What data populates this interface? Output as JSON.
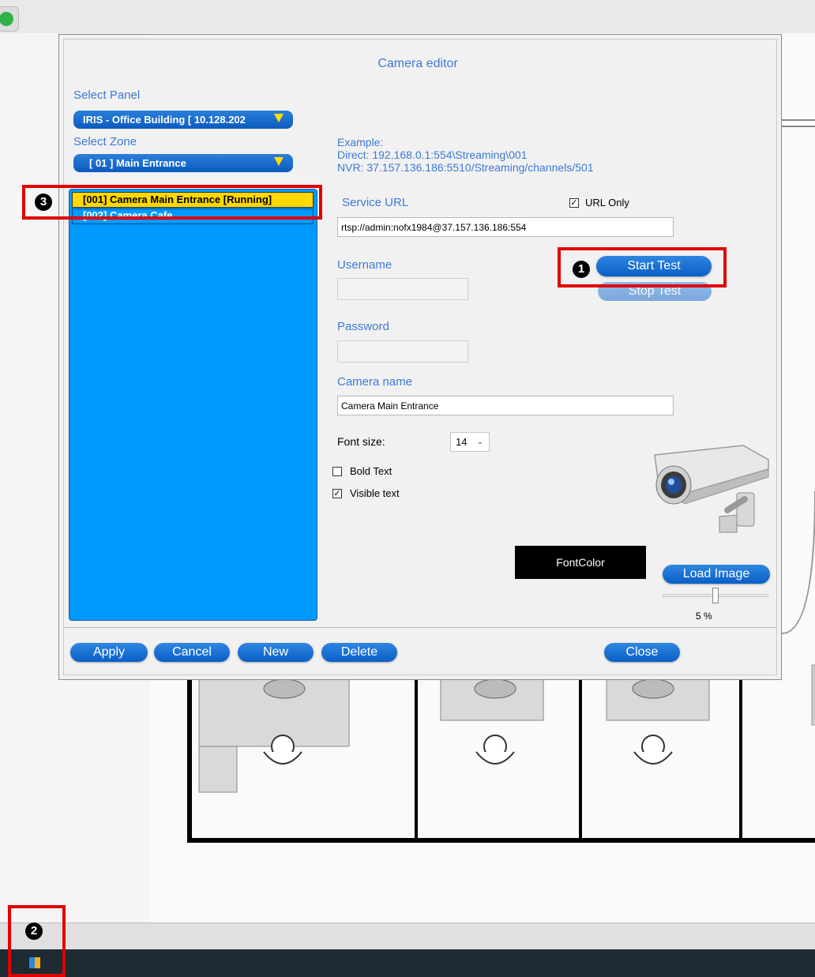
{
  "dialog": {
    "title": "Camera editor",
    "select_panel_label": "Select Panel",
    "select_panel_value": "IRIS - Office Building [ 10.128.202",
    "select_zone_label": "Select Zone",
    "select_zone_value": "[ 01 ] Main Entrance",
    "cameras": [
      {
        "label": "[001] Camera Main Entrance [Running]"
      },
      {
        "label": "[002] Camera Cafe"
      }
    ],
    "example_lines": [
      "Example:",
      "Direct: 192.168.0.1:554\\Streaming\\001",
      "NVR: 37.157.136.186:5510/Streaming/channels/501"
    ],
    "service_url_label": "Service URL",
    "url_only_label": "URL Only",
    "url_only_checked": true,
    "service_url_value": "rtsp://admin:nofx1984@37.157.136.186:554",
    "username_label": "Username",
    "username_value": "",
    "password_label": "Password",
    "password_value": "",
    "start_test_label": "Start Test",
    "stop_test_label": "Stop Test",
    "camera_name_label": "Camera name",
    "camera_name_value": "Camera Main Entrance",
    "font_size_label": "Font size:",
    "font_size_value": "14",
    "bold_text_label": "Bold Text",
    "bold_text_checked": false,
    "visible_text_label": "Visible text",
    "visible_text_checked": true,
    "font_color_label": "FontColor",
    "load_image_label": "Load Image",
    "zoom_percent": "5 %",
    "zoom_level": 0.5,
    "buttons": {
      "apply": "Apply",
      "cancel": "Cancel",
      "new": "New",
      "delete": "Delete",
      "close": "Close"
    }
  },
  "annotations": {
    "marker_1": "❶",
    "marker_2": "❷",
    "marker_3": "❸"
  },
  "colors": {
    "list_bg": "#0099ff",
    "selected_row": "#ffd800",
    "highlight_red": "#e00000",
    "label_blue": "#3d7ad6"
  }
}
